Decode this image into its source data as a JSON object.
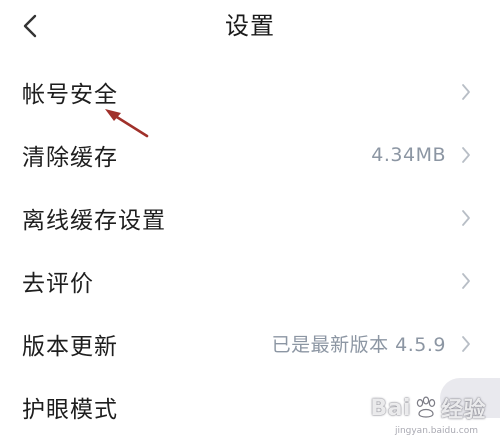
{
  "header": {
    "title": "设置",
    "back_icon": "chevron-left-icon"
  },
  "settings": {
    "items": [
      {
        "label": "帐号安全",
        "value": "",
        "has_chevron": true
      },
      {
        "label": "清除缓存",
        "value": "4.34MB",
        "has_chevron": true
      },
      {
        "label": "离线缓存设置",
        "value": "",
        "has_chevron": true
      },
      {
        "label": "去评价",
        "value": "",
        "has_chevron": true
      },
      {
        "label": "版本更新",
        "value": "已是最新版本 4.5.9",
        "has_chevron": true
      },
      {
        "label": "护眼模式",
        "value": "",
        "has_chevron": false
      }
    ]
  },
  "watermark": {
    "brand_left": "Bai",
    "brand_right": "经验",
    "domain": "jingyan.baidu.com"
  },
  "colors": {
    "text": "#1e1e1e",
    "secondary": "#8c96a3",
    "chevron": "#b8bec6",
    "annotation": "#a0302a"
  }
}
